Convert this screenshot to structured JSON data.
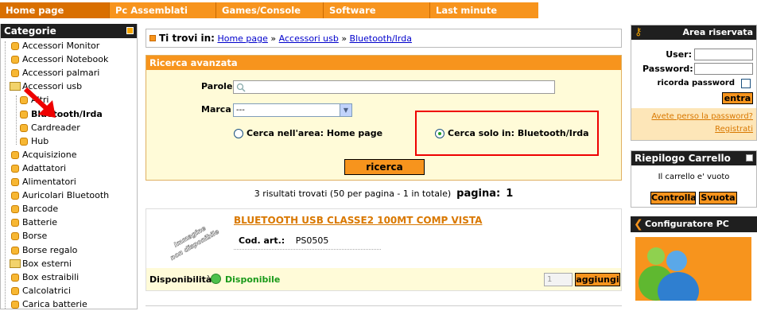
{
  "nav": {
    "tabs": [
      "Home page",
      "Pc Assemblati",
      "Games/Console",
      "Software",
      "Last minute"
    ]
  },
  "sidebar": {
    "title": "Categorie",
    "items": [
      {
        "label": "Accessori Monitor",
        "level": 0,
        "folder": false
      },
      {
        "label": "Accessori Notebook",
        "level": 0,
        "folder": false
      },
      {
        "label": "Accessori palmari",
        "level": 0,
        "folder": false
      },
      {
        "label": "Accessori usb",
        "level": 0,
        "folder": true
      },
      {
        "label": "Altri",
        "level": 1,
        "folder": false
      },
      {
        "label": "Bluetooth/Irda",
        "level": 1,
        "folder": false,
        "selected": true
      },
      {
        "label": "Cardreader",
        "level": 1,
        "folder": false
      },
      {
        "label": "Hub",
        "level": 1,
        "folder": false
      },
      {
        "label": "Acquisizione",
        "level": 0,
        "folder": false
      },
      {
        "label": "Adattatori",
        "level": 0,
        "folder": false
      },
      {
        "label": "Alimentatori",
        "level": 0,
        "folder": false
      },
      {
        "label": "Auricolari Bluetooth",
        "level": 0,
        "folder": false
      },
      {
        "label": "Barcode",
        "level": 0,
        "folder": false
      },
      {
        "label": "Batterie",
        "level": 0,
        "folder": false
      },
      {
        "label": "Borse",
        "level": 0,
        "folder": false
      },
      {
        "label": "Borse regalo",
        "level": 0,
        "folder": false
      },
      {
        "label": "Box esterni",
        "level": 0,
        "folder": true
      },
      {
        "label": "Box estraibili",
        "level": 0,
        "folder": false
      },
      {
        "label": "Calcolatrici",
        "level": 0,
        "folder": false
      },
      {
        "label": "Carica batterie",
        "level": 0,
        "folder": false
      }
    ]
  },
  "breadcrumb": {
    "prefix": "Ti trovi in:",
    "links": [
      "Home page",
      "Accessori usb",
      "Bluetooth/Irda"
    ],
    "sep": "»"
  },
  "search": {
    "title": "Ricerca avanzata",
    "words_label": "Parole",
    "brand_label": "Marca",
    "brand_value": "---",
    "radio_area": "Cerca nell'area: Home page",
    "radio_only": "Cerca solo in: Bluetooth/Irda",
    "submit": "ricerca"
  },
  "results": {
    "summary": "3 risultati trovati (50 per pagina - 1 in totale)",
    "page_label": "pagina:",
    "page": "1"
  },
  "product": {
    "image_text": "Immagine non disponibile",
    "title": "BLUETOOTH USB CLASSE2 100MT COMP VISTA",
    "code_label": "Cod. art.:",
    "code": "PS0505",
    "avail_label": "Disponibilità:",
    "avail_value": "Disponibile",
    "qty": "1",
    "add_label": "aggiungi"
  },
  "login": {
    "title": "Area riservata",
    "user_label": "User:",
    "pass_label": "Password:",
    "remember_label": "ricorda password",
    "submit": "entra",
    "lost": "Avete perso la password?",
    "register": "Registrati"
  },
  "cart": {
    "title": "Riepilogo Carrello",
    "empty": "Il carrello e' vuoto",
    "check": "Controlla",
    "empty_btn": "Svuota"
  },
  "configurator": {
    "title": "Configuratore PC"
  },
  "colors": {
    "accent": "#f7941d",
    "header_dark": "#1f1f1f",
    "panel_bg": "#fffbd8",
    "highlight": "#ee0000"
  }
}
